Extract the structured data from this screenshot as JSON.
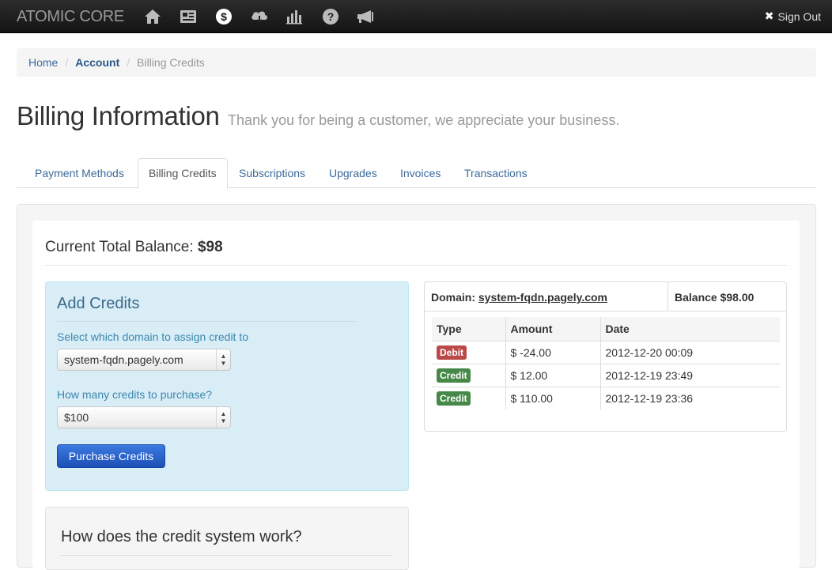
{
  "navbar": {
    "brand": "ATOMIC CORE",
    "icons": [
      "home-icon",
      "dashboard-icon",
      "dollar-icon",
      "cloud-download-icon",
      "bar-chart-icon",
      "help-icon",
      "megaphone-icon"
    ],
    "sign_out": "Sign Out",
    "background": "#1b1b1b"
  },
  "breadcrumb": {
    "home": "Home",
    "account": "Account",
    "current": "Billing Credits",
    "separator": "/"
  },
  "header": {
    "title": "Billing Information",
    "subtitle": "Thank you for being a customer, we appreciate your business."
  },
  "tabs": [
    {
      "label": "Payment Methods"
    },
    {
      "label": "Billing Credits",
      "active": true
    },
    {
      "label": "Subscriptions"
    },
    {
      "label": "Upgrades"
    },
    {
      "label": "Invoices"
    },
    {
      "label": "Transactions"
    }
  ],
  "balance": {
    "label": "Current Total Balance:",
    "value": "$98"
  },
  "add_credits": {
    "title": "Add Credits",
    "domain_label": "Select which domain to assign credit to",
    "domain_selected": "system-fqdn.pagely.com",
    "amount_label": "How many credits to purchase?",
    "amount_selected": "$100",
    "purchase_button": "Purchase Credits"
  },
  "how": {
    "title": "How does the credit system work?"
  },
  "domain_table": {
    "domain_label": "Domain:",
    "domain_value": "system-fqdn.pagely.com",
    "balance_label": "Balance $98.00",
    "columns": [
      "Type",
      "Amount",
      "Date"
    ],
    "rows": [
      {
        "type": "Debit",
        "amount": "$ -24.00",
        "date": "2012-12-20 00:09"
      },
      {
        "type": "Credit",
        "amount": "$ 12.00",
        "date": "2012-12-19 23:49"
      },
      {
        "type": "Credit",
        "amount": "$ 110.00",
        "date": "2012-12-19 23:36"
      }
    ]
  },
  "colors": {
    "link": "#3a6a9b",
    "debit": "#b94a48",
    "credit": "#468847",
    "info_box": "#d9edf7",
    "primary_button": "#2a62cc"
  }
}
